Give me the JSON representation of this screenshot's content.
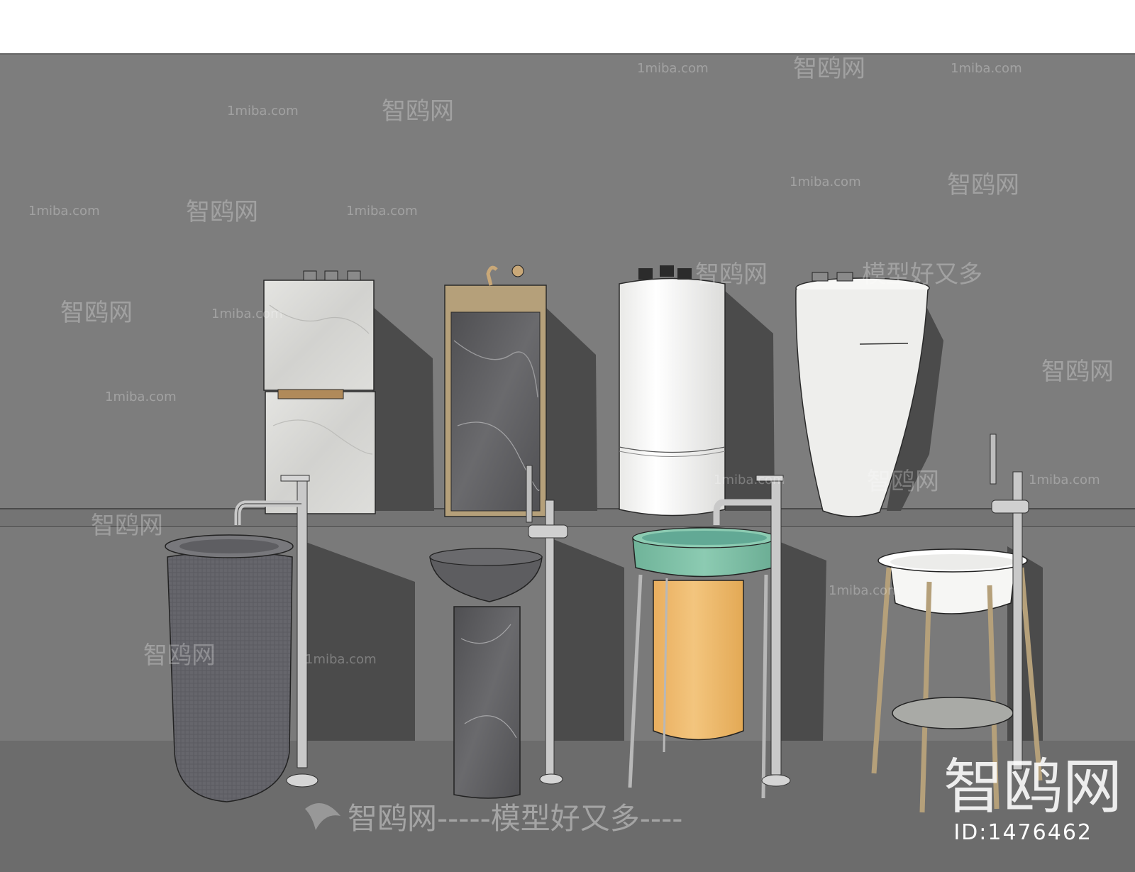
{
  "scene": {
    "colors": {
      "wall": "#7d7d7d",
      "floor": "#6c6c6c",
      "shelf": "#747474",
      "shadow": "#4b4b4b",
      "header": "#ffffff",
      "marble_light": "#d9d9d6",
      "marble_dark": "#5e5e60",
      "wood": "#b5a07a",
      "basin_green": "#7fbfa6",
      "cylinder_orange": "#eebb70",
      "ceramic_white": "#f4f4f2",
      "stone_grey": "#6a6a70",
      "chrome": "#c9c9c9"
    },
    "objects": [
      "marble-cabinet-back",
      "marble-wood-cabinet-back",
      "white-cylinder-basin-back",
      "white-pedestal-basin-back",
      "stone-pedestal-basin",
      "marble-column-basin",
      "green-basin-orange-stand",
      "white-basin-wood-stand"
    ]
  },
  "watermarks": {
    "brand_cn": "智鸥网",
    "site": "1miba.com",
    "slogan_cn": "模型好又多",
    "bottom_text": "智鸥网-----模型好又多----",
    "top_left_text": "------ 智鸥网------",
    "large_logo": "智鸥网",
    "id_label": "ID:1476462"
  }
}
